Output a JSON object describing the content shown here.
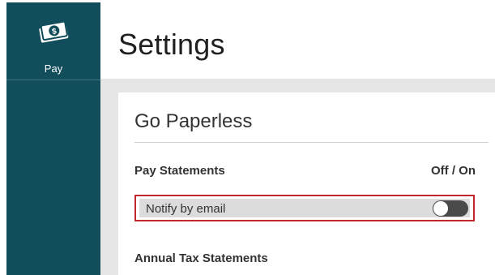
{
  "sidebar": {
    "items": [
      {
        "label": "Pay",
        "icon": "money-icon"
      }
    ],
    "color": "#114d5a"
  },
  "header": {
    "title": "Settings"
  },
  "card": {
    "title": "Go Paperless",
    "sections": {
      "pay_statements": {
        "label": "Pay Statements",
        "toggle_header": "Off / On",
        "notify": {
          "label": "Notify by email",
          "enabled": false
        }
      },
      "annual_tax": {
        "label": "Annual Tax Statements"
      }
    }
  },
  "colors": {
    "sidebar": "#114d5a",
    "highlight_border": "#c1272d",
    "toggle_off": "#4a4a4a"
  }
}
